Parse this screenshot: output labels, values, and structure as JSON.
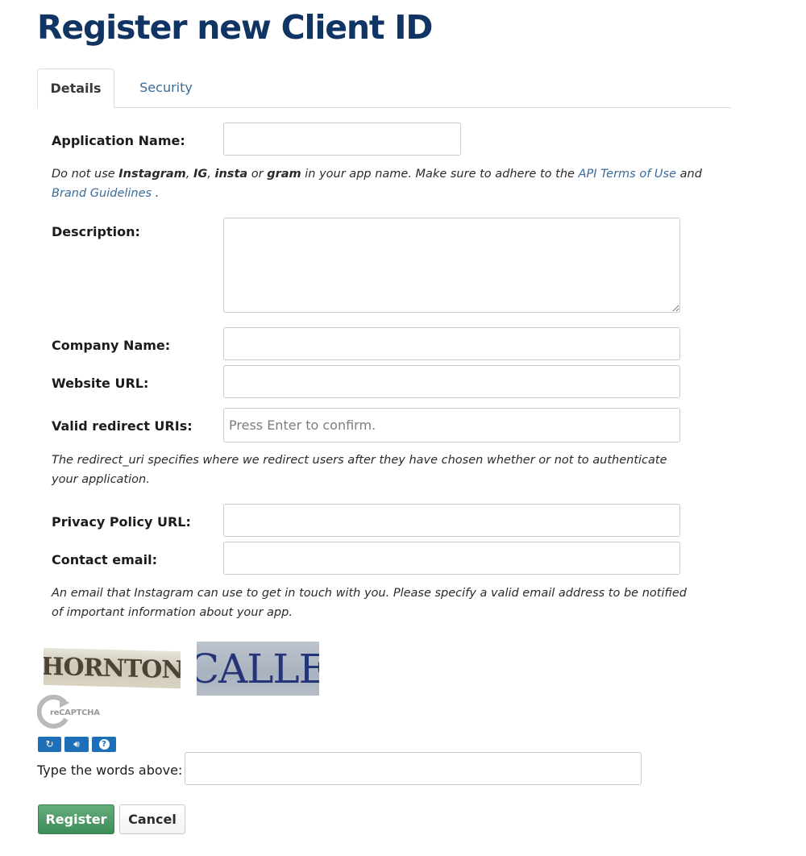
{
  "page_title": "Register new Client ID",
  "tabs": [
    {
      "label": "Details",
      "active": true
    },
    {
      "label": "Security",
      "active": false
    }
  ],
  "form": {
    "application_name": {
      "label": "Application Name:",
      "value": ""
    },
    "app_name_help": {
      "t1": "Do not use ",
      "b1": "Instagram",
      "t2": ", ",
      "b2": "IG",
      "t3": ", ",
      "b3": "insta",
      "t4": " or ",
      "b4": "gram",
      "t5": " in your app name. Make sure to adhere to the ",
      "link1": "API Terms of Use",
      "t6": " and ",
      "link2": "Brand Guidelines",
      "t7": " ."
    },
    "description": {
      "label": "Description:",
      "value": ""
    },
    "company_name": {
      "label": "Company Name:",
      "value": ""
    },
    "website_url": {
      "label": "Website URL:",
      "value": ""
    },
    "redirect_uris": {
      "label": "Valid redirect URIs:",
      "placeholder": "Press Enter to confirm.",
      "value": ""
    },
    "redirect_help": "The redirect_uri specifies where we redirect users after they have chosen whether or not to authenticate your application.",
    "privacy_policy_url": {
      "label": "Privacy Policy URL:",
      "value": ""
    },
    "contact_email": {
      "label": "Contact email:",
      "value": ""
    },
    "email_help": "An email that Instagram can use to get in touch with you. Please specify a valid email address to be notified of important information about your app."
  },
  "captcha": {
    "word1": "HORNTON",
    "word2": "CALLE",
    "logo_text": "reCAPTCHA",
    "buttons": [
      "refresh-icon",
      "audio-icon",
      "help-icon"
    ],
    "type_label": "Type the words above:",
    "value": ""
  },
  "actions": {
    "register_label": "Register",
    "cancel_label": "Cancel",
    "register_color": "#4a9a64"
  },
  "colors": {
    "title": "#103463",
    "link": "#3a6c9a"
  }
}
